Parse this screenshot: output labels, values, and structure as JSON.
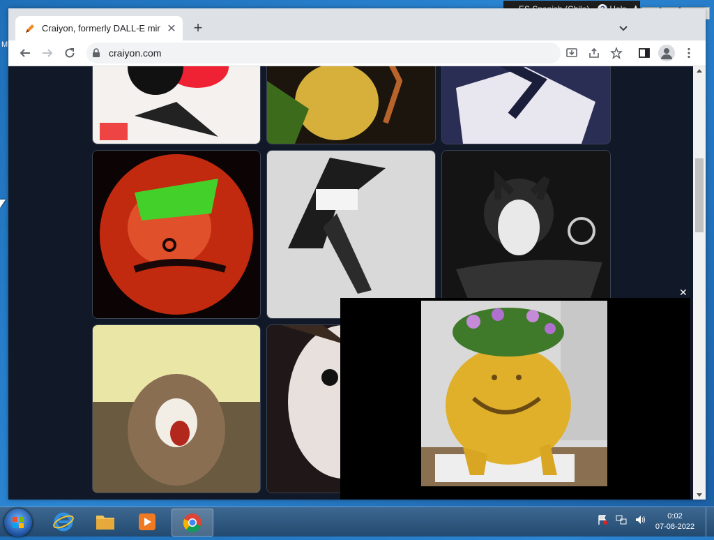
{
  "desktop": {
    "edge_letter": "M"
  },
  "browser": {
    "tab": {
      "title": "Craiyon, formerly DALL-E mini",
      "close_glyph": "✕",
      "favicon": "craiyon-pencil-icon"
    },
    "new_tab_glyph": "+",
    "toolbar": {
      "back": "back-arrow-icon",
      "forward": "forward-arrow-icon",
      "reload": "reload-icon",
      "url": "craiyon.com"
    }
  },
  "page": {
    "popup_close": "✕"
  },
  "language_bar": {
    "language": "ES Spanish (Chile)",
    "help": "Help",
    "help_glyph": "?"
  },
  "window_controls": {
    "minimize": "—",
    "restore": "❐",
    "close": "✕"
  },
  "taskbar": {
    "apps": [
      "internet-explorer-icon",
      "file-explorer-icon",
      "media-player-icon",
      "chrome-icon"
    ],
    "clock": {
      "time": "0:02",
      "date": "07-08-2022"
    }
  },
  "colors": {
    "page_bg": "#111827",
    "accent": "#f08a24"
  }
}
